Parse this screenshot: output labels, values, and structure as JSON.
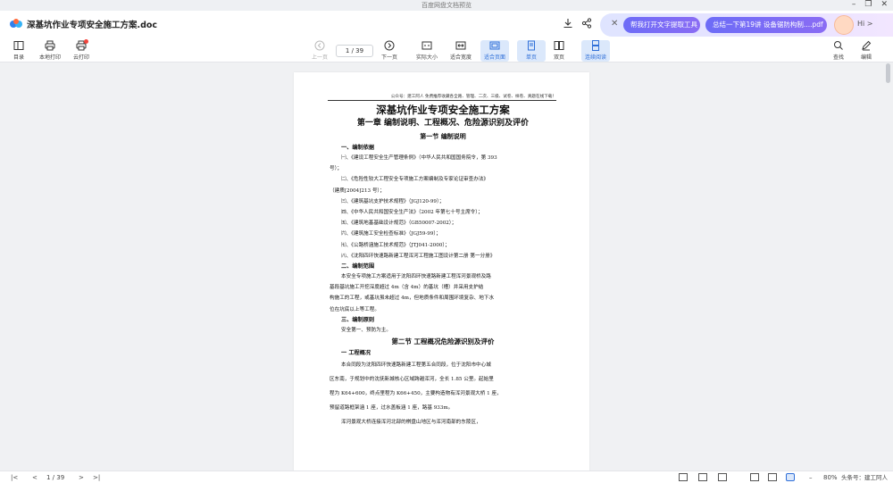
{
  "window": {
    "caption": "百度网盘文档预览"
  },
  "header": {
    "doc_title": "深基坑作业专项安全施工方案.doc"
  },
  "ai": {
    "pill1": "帮我打开文字提取工具",
    "pill2": "总结一下第19讲  设备锯防构制....pdf",
    "greeting": "Hi >"
  },
  "toolbar": {
    "toc": "目录",
    "local_print": "本地打印",
    "cloud_print": "云打印",
    "prev": "上一页",
    "page_indicator": "1 / 39",
    "next": "下一页",
    "actual_size": "实际大小",
    "fit_width": "适合宽度",
    "fit_page": "适合页面",
    "single": "单页",
    "double": "双页",
    "continuous": "连续阅读",
    "find": "查找",
    "edit": "编辑"
  },
  "document": {
    "header_note": "公众号：建工阿人  免费推荐收藏各全路、管理、二次、三级、试卷、样卷、真题在线下载！",
    "title": "深基坑作业专项安全施工方案",
    "chapter1": "第一章    编制说明、工程概况、危险源识别及评价",
    "section1": "第一节    编制说明",
    "sub1": "一、编制依据",
    "b1a": "㈠、《建设工程安全生产管理条例》（中华人民共和国国务院令，第 393",
    "b1b": "号）；",
    "b2a": "㈡、《危险性较大工程安全专项施工方案编制及专家论证审查办法》",
    "b2b": "（建质[2004]213 号）；",
    "b3": "㈢、《建筑基坑支护技术规程》（JGJ120-99）；",
    "b4": "㈣、《中华人民共和国安全生产法》（2002 年第七十号主席令）；",
    "b5": "㈤、《建筑地基基础设计规范》（GB50007-2002）；",
    "b6": "㈥、《建筑施工安全检查标准》（JGJ59-99）；",
    "b7": "㈦、《公路桥涵施工技术规范》（JTJ041-2000）；",
    "b8": "㈧、《沈阳四环快速路新建工程浑河工程施工图设计第二册 第一分册》",
    "sub2": "二、编制范围",
    "s2a": "本安全专项施工方案适用于沈阳四环快速路新建工程浑河景观桥及路",
    "s2b": "基段基坑施工开挖深度超过 4m（含 4m）的基坑（槽）并采用支护结",
    "s2c": "构施工的工程，或基坑虽未超过 4m，但地质条件和周围环境复杂、地下水",
    "s2d": "位在坑底以上等工程。",
    "sub3": "三、编制原则",
    "s3": "安全第一、预防为主。",
    "section2": "第二节    工程概况危险源识别及评价",
    "sub4": "一  工程概况",
    "g1": "本合同段为沈阳四环快速路新建工程第五合同段，位于沈阳市中心城",
    "g2": "区东南，于规划中的沈抚新城核心区域跨越浑河，全长 1.85 公里。起始里",
    "g3": "程为 K64+600，终点里程为 K66+450，主要构造物有浑河景观大桥 1 座，",
    "g4": "预留道路框架涵 1 座，过水盖板涵 1 座，路基 933m。",
    "g5": "浑河景观大桥连接浑河北部的棋盘山地区与浑河南部的东陵区，"
  },
  "status": {
    "page": "1 / 39",
    "zoom": "80%",
    "watermark": "头条号：建工阿人"
  }
}
